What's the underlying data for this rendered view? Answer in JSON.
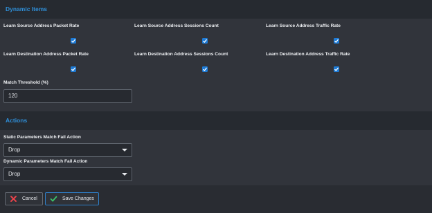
{
  "sections": {
    "dynamic_items": "Dynamic Items",
    "actions": "Actions"
  },
  "dynamic_items": {
    "checkboxes": [
      {
        "label": "Learn Source Address Packet Rate",
        "checked": true
      },
      {
        "label": "Learn Source Address Sessions Count",
        "checked": true
      },
      {
        "label": "Learn Source Address Traffic Rate",
        "checked": true
      },
      {
        "label": "Learn Destination Address Packet Rate",
        "checked": true
      },
      {
        "label": "Learn Destination Address Sessions Count",
        "checked": true
      },
      {
        "label": "Learn Destination Address Traffic Rate",
        "checked": true
      }
    ],
    "match_threshold": {
      "label": "Match Threshold (%)",
      "value": "120"
    }
  },
  "actions": {
    "static_fail": {
      "label": "Static Parameters Match Fail Action",
      "value": "Drop"
    },
    "dynamic_fail": {
      "label": "Dynamic Parameters Match Fail Action",
      "value": "Drop"
    }
  },
  "footer": {
    "cancel_label": "Cancel",
    "save_label": "Save Changes"
  },
  "colors": {
    "accent": "#2f8fd8",
    "checkbox": "#1e7bd6",
    "cancel_icon": "#e5424a",
    "save_icon": "#3cc46a"
  }
}
